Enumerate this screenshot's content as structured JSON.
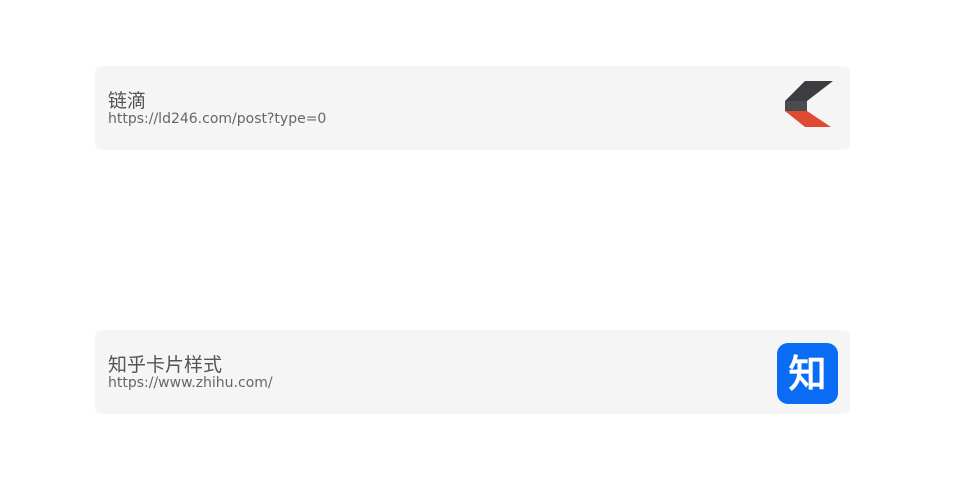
{
  "cards": [
    {
      "title": "链滴",
      "url": "https://ld246.com/post?type=0",
      "icon": "liandi-logo-icon",
      "colors": {
        "dark": "#3c3d40",
        "accent": "#e04a32"
      }
    },
    {
      "title": "知乎卡片样式",
      "url": "https://www.zhihu.com/",
      "icon": "zhihu-logo-icon",
      "icon_text": "知",
      "colors": {
        "brand": "#0a6cf5"
      }
    }
  ]
}
